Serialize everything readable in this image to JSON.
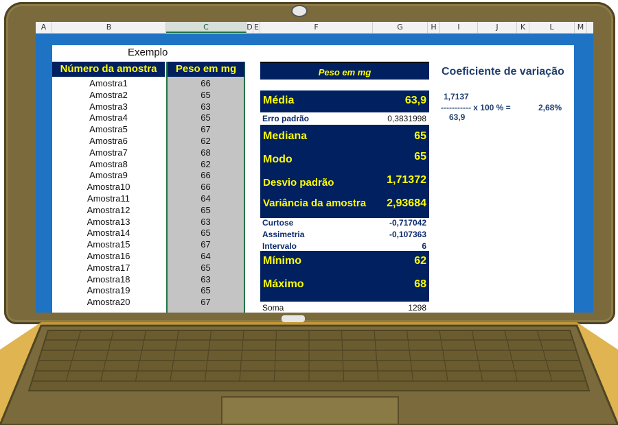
{
  "spreadsheet": {
    "columns": [
      "A",
      "B",
      "C",
      "D",
      "E",
      "F",
      "G",
      "H",
      "I",
      "J",
      "K",
      "L",
      "M"
    ],
    "title": "Exemplo",
    "table": {
      "header_sample": "Número da amostra",
      "header_weight": "Peso em mg",
      "rows": [
        {
          "name": "Amostra1",
          "value": "66"
        },
        {
          "name": "Amostra2",
          "value": "65"
        },
        {
          "name": "Amostra3",
          "value": "63"
        },
        {
          "name": "Amostra4",
          "value": "65"
        },
        {
          "name": "Amostra5",
          "value": "67"
        },
        {
          "name": "Amostra6",
          "value": "62"
        },
        {
          "name": "Amostra7",
          "value": "68"
        },
        {
          "name": "Amostra8",
          "value": "62"
        },
        {
          "name": "Amostra9",
          "value": "66"
        },
        {
          "name": "Amostra10",
          "value": "66"
        },
        {
          "name": "Amostra11",
          "value": "64"
        },
        {
          "name": "Amostra12",
          "value": "65"
        },
        {
          "name": "Amostra13",
          "value": "63"
        },
        {
          "name": "Amostra14",
          "value": "65"
        },
        {
          "name": "Amostra15",
          "value": "67"
        },
        {
          "name": "Amostra16",
          "value": "64"
        },
        {
          "name": "Amostra17",
          "value": "65"
        },
        {
          "name": "Amostra18",
          "value": "63"
        },
        {
          "name": "Amostra19",
          "value": "65"
        },
        {
          "name": "Amostra20",
          "value": "67"
        }
      ]
    },
    "stats": {
      "header": "Peso em mg",
      "media_label": "Média",
      "media_value": "63,9",
      "erro_label": "Erro padrão",
      "erro_value": "0,3831998",
      "mediana_label": "Mediana",
      "mediana_value": "65",
      "modo_label": "Modo",
      "modo_value": "65",
      "desvio_label": "Desvio padrão",
      "desvio_value": "1,71372",
      "variancia_label": "Variância da amostra",
      "variancia_value": "2,93684",
      "curtose_label": "Curtose",
      "curtose_value": "-0,717042",
      "assimetria_label": "Assimetria",
      "assimetria_value": "-0,107363",
      "intervalo_label": "Intervalo",
      "intervalo_value": "6",
      "minimo_label": "Mínimo",
      "minimo_value": "62",
      "maximo_label": "Máximo",
      "maximo_value": "68",
      "soma_label": "Soma",
      "soma_value": "1298"
    },
    "coef_var": {
      "title": "Coeficiente de variação",
      "numerator": "1,7137",
      "fraction_line": "----------- x 100 % =",
      "result": "2,68%",
      "denominator": "63,9"
    }
  },
  "colors": {
    "navy": "#002060",
    "yellow_text": "#ffff00",
    "excel_green": "#217346",
    "screen_blue": "#1f73c4",
    "laptop_body": "#7a6a3c"
  }
}
